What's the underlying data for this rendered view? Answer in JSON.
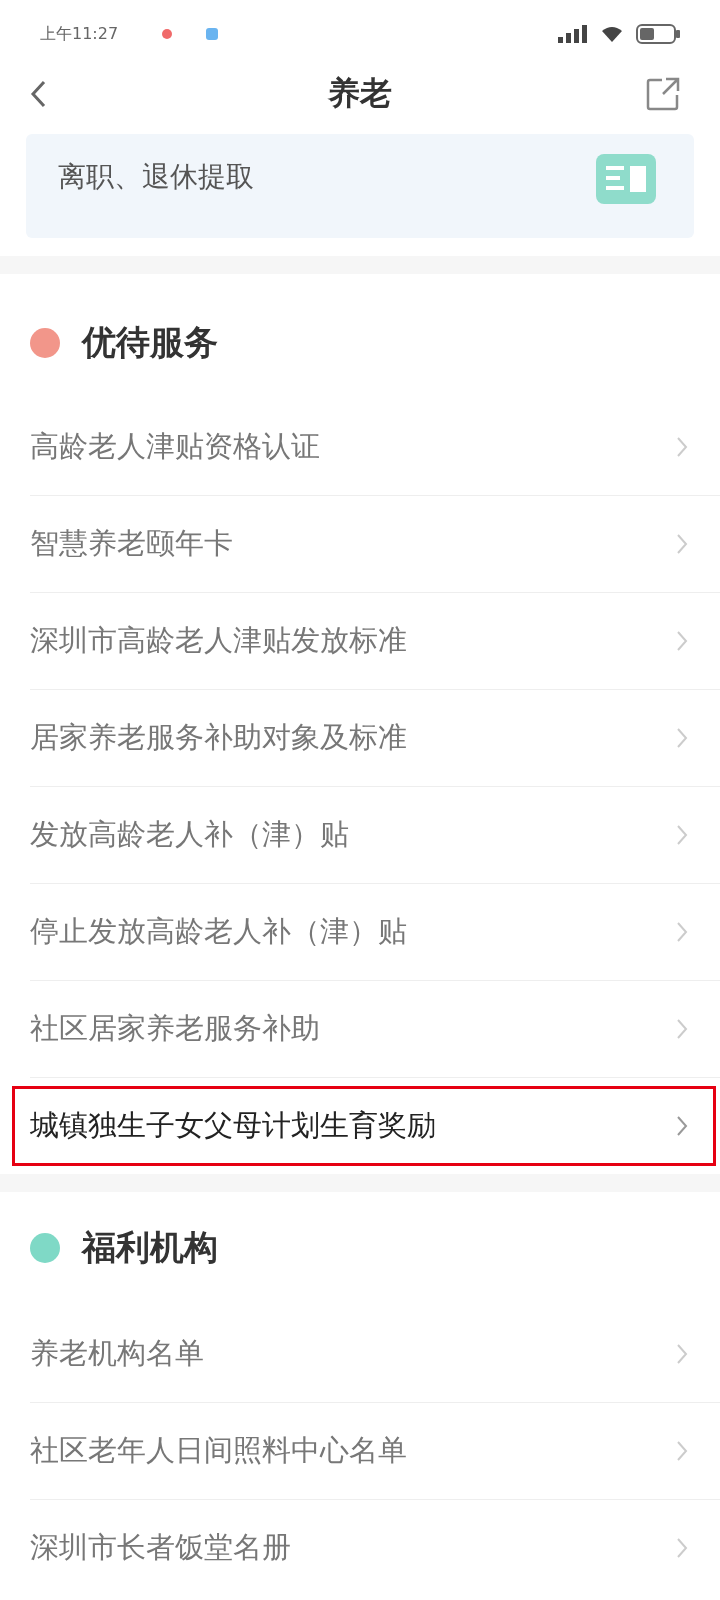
{
  "status_bar": {
    "time": "上午11:27"
  },
  "nav": {
    "title": "养老"
  },
  "banner": {
    "label": "离职、退休提取"
  },
  "sections": [
    {
      "title": "优待服务",
      "color": "#f2968a",
      "items": [
        {
          "label": "高龄老人津贴资格认证",
          "highlighted": false
        },
        {
          "label": "智慧养老颐年卡",
          "highlighted": false
        },
        {
          "label": "深圳市高龄老人津贴发放标准",
          "highlighted": false
        },
        {
          "label": "居家养老服务补助对象及标准",
          "highlighted": false
        },
        {
          "label": "发放高龄老人补（津）贴",
          "highlighted": false
        },
        {
          "label": "停止发放高龄老人补（津）贴",
          "highlighted": false
        },
        {
          "label": "社区居家养老服务补助",
          "highlighted": false
        },
        {
          "label": "城镇独生子女父母计划生育奖励",
          "highlighted": true
        }
      ]
    },
    {
      "title": "福利机构",
      "color": "#7fd9c6",
      "items": [
        {
          "label": "养老机构名单",
          "highlighted": false
        },
        {
          "label": "社区老年人日间照料中心名单",
          "highlighted": false
        },
        {
          "label": "深圳市长者饭堂名册",
          "highlighted": false
        }
      ]
    }
  ]
}
